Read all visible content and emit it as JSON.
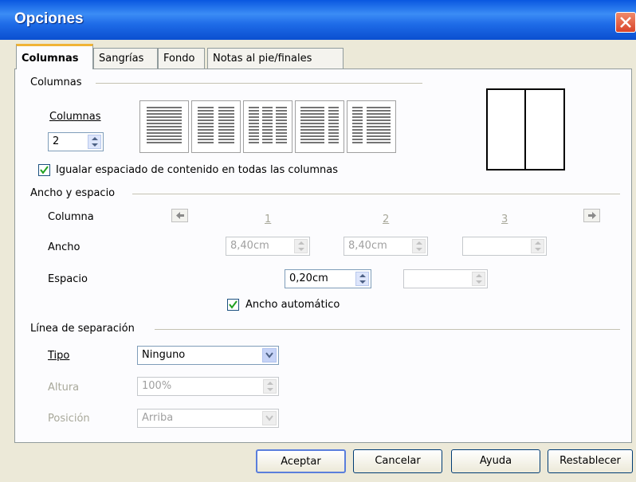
{
  "window": {
    "title": "Opciones"
  },
  "tabs": [
    {
      "label": "Columnas"
    },
    {
      "label": "Sangrías"
    },
    {
      "label": "Fondo"
    },
    {
      "label": "Notas al pie/finales"
    }
  ],
  "columnas_section": {
    "title": "Columnas",
    "columns_label": "Columnas",
    "columns_value": "2",
    "equalize_label": "Igualar espaciado de contenido en todas las columnas",
    "equalize_checked": true
  },
  "width_section": {
    "title": "Ancho y espacio",
    "column_label": "Columna",
    "col_numbers": [
      "1",
      "2",
      "3"
    ],
    "width_label": "Ancho",
    "widths": [
      "8,40cm",
      "8,40cm",
      ""
    ],
    "spacing_label": "Espacio",
    "spacings": [
      "0,20cm",
      ""
    ],
    "auto_width_label": "Ancho automático",
    "auto_width_checked": true
  },
  "separator_section": {
    "title": "Línea de separación",
    "type_label": "Tipo",
    "type_value": "Ninguno",
    "height_label": "Altura",
    "height_value": "100%",
    "position_label": "Posición",
    "position_value": "Arriba"
  },
  "buttons": {
    "ok": "Aceptar",
    "cancel": "Cancelar",
    "help": "Ayuda",
    "reset": "Restablecer"
  },
  "colors": {
    "title_bar": "#0a58e0",
    "tab_highlight": "#f0b435",
    "dialog_bg": "#ece9d8"
  }
}
